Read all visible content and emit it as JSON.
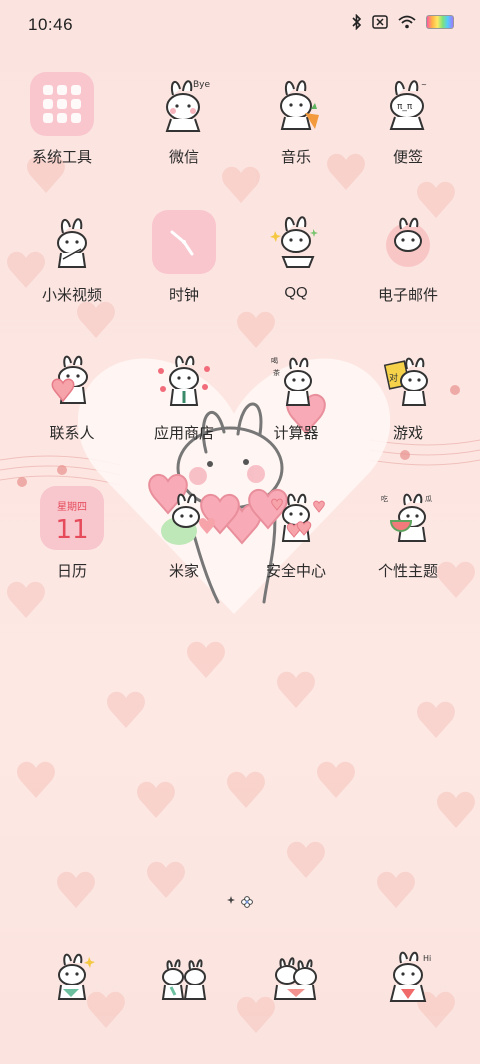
{
  "status": {
    "time": "10:46",
    "icons": [
      "bluetooth-icon",
      "no-sim-icon",
      "wifi-icon",
      "battery-icon"
    ]
  },
  "apps": [
    {
      "label": "系统工具",
      "icon": "folder-icon"
    },
    {
      "label": "微信",
      "icon": "bunny-bye-icon"
    },
    {
      "label": "音乐",
      "icon": "bunny-carrot-icon"
    },
    {
      "label": "便签",
      "icon": "bunny-crying-icon"
    },
    {
      "label": "小米视频",
      "icon": "bunny-bowl-icon"
    },
    {
      "label": "时钟",
      "icon": "clock-icon"
    },
    {
      "label": "QQ",
      "icon": "bunny-sparkle-icon"
    },
    {
      "label": "电子邮件",
      "icon": "bunny-blanket-icon"
    },
    {
      "label": "联系人",
      "icon": "bunny-heart-icon"
    },
    {
      "label": "应用商店",
      "icon": "bunny-hearts-icon"
    },
    {
      "label": "计算器",
      "icon": "bunny-tea-icon"
    },
    {
      "label": "游戏",
      "icon": "bunny-card-icon"
    },
    {
      "label": "日历",
      "icon": "calendar-icon",
      "weekday": "星期四",
      "day": "11"
    },
    {
      "label": "米家",
      "icon": "bunny-heartbox-icon"
    },
    {
      "label": "安全中心",
      "icon": "bunny-bouquet-icon"
    },
    {
      "label": "个性主题",
      "icon": "bunny-watermelon-icon"
    }
  ],
  "dock": [
    {
      "icon": "bunny-sparkle-dock-icon"
    },
    {
      "icon": "two-bunnies-dock-icon"
    },
    {
      "icon": "bunny-hug-dock-icon"
    },
    {
      "icon": "bunny-hi-dock-icon"
    }
  ],
  "colors": {
    "accent": "#e54b5b",
    "tile": "#f9c6ce",
    "background": "#fbe3df"
  }
}
